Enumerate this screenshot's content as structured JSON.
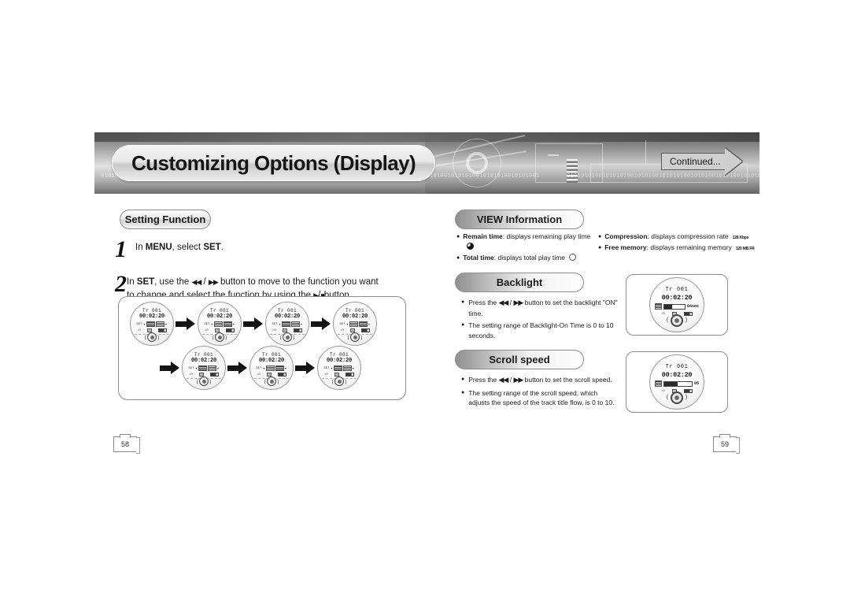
{
  "header": {
    "title": "Customizing Options (Display)",
    "continued_label": "Continued...",
    "binary_strips": [
      "01010101001011010010101010010101010010101001010101001010101",
      "01001010010101001010100101001010010101010010101010010101001",
      "010101010010101010010101001010101001010100101010010101010010"
    ]
  },
  "left_column": {
    "section_title": "Setting Function",
    "steps": [
      {
        "num": "1",
        "text_html": "In <b>MENU</b>, select <b>SET</b>."
      },
      {
        "num": "2",
        "text_html": "In <b>SET</b>, use the <span class=\"gly\">◀◀</span> / <span class=\"gly\">▶▶</span> button to move to the function you want to change and select the function by using the <span class=\"gly\">▶</span>/<span class=\"gly\">■</span>button."
      }
    ],
    "flow": {
      "row1": [
        {
          "track": "Tr  001",
          "time": "00:02:20",
          "set_label": "SET"
        },
        {
          "track": "Tr  001",
          "time": "00:02:20",
          "set_label": "SET"
        },
        {
          "track": "Tr  001",
          "time": "00:02:20",
          "set_label": "SET"
        },
        {
          "track": "Tr  001",
          "time": "00:02:20",
          "set_label": "SET"
        }
      ],
      "row2": [
        {
          "track": "Tr  001",
          "time": "00:02:20",
          "set_label": "SET"
        },
        {
          "track": "Tr  001",
          "time": "00:02:20",
          "set_label": "SET"
        },
        {
          "track": "Tr  001",
          "time": "00:02:20",
          "set_label": "SET"
        }
      ]
    }
  },
  "right_column": {
    "view_information": {
      "title": "VIEW Information",
      "left_items": [
        {
          "term": "Remain time",
          "desc": ": displays remaining play time",
          "icon": "pie-full-icon"
        },
        {
          "term": "Total time",
          "desc": ": displays total play time",
          "icon": "pie-empty-icon"
        }
      ],
      "right_items": [
        {
          "term": "Compression",
          "desc": ": displays compression rate",
          "badge": "128 Kbps"
        },
        {
          "term": "Free memory",
          "desc": ": displays remaining memory",
          "badge": "120 MB FR"
        }
      ]
    },
    "backlight": {
      "title": "Backlight",
      "bullets_html": [
        "Press the <span class=\"gly\">◀◀</span> / <span class=\"gly\">▶▶</span> button to set the backlight \"ON\" time.",
        "The setting range of Backlight-On Time is 0 to 10 seconds."
      ],
      "device": {
        "track": "Tr  001",
        "time": "00:02:20",
        "value": "04sec",
        "gauge_percent": 40
      }
    },
    "scroll_speed": {
      "title": "Scroll speed",
      "bullets_html": [
        "Press the <span class=\"gly\">◀◀</span> / <span class=\"gly\">▶▶</span> button to set the scroll speed.",
        "The setting range of the scroll speed, which adjusts the speed of the track title flow, is 0 to 10."
      ],
      "device": {
        "track": "Tr  001",
        "time": "00:02:20",
        "value": "05",
        "gauge_percent": 50
      }
    }
  },
  "page_numbers": {
    "left": "58",
    "right": "59"
  }
}
